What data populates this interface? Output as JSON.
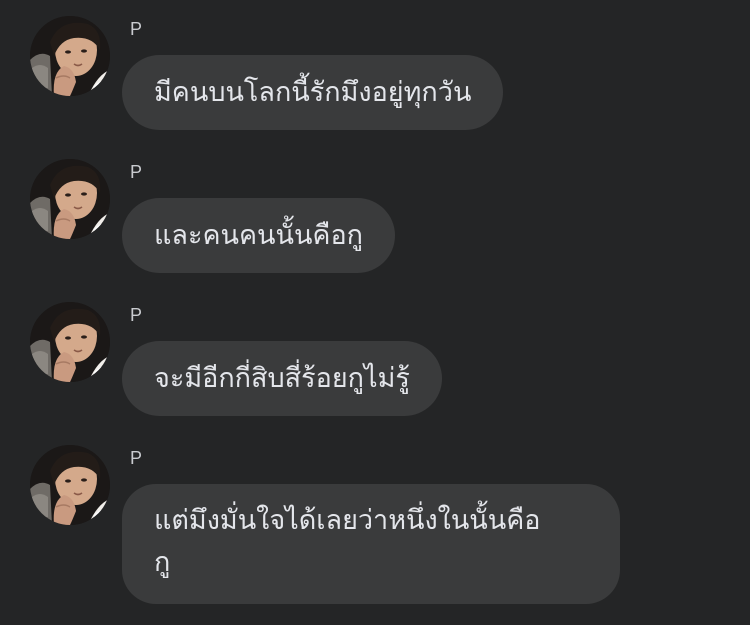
{
  "messages": [
    {
      "sender": "P",
      "text": "มีคนบนโลกนี้รักมึงอยู่ทุกวัน"
    },
    {
      "sender": "P",
      "text": "และคนคนนั้นคือกู"
    },
    {
      "sender": "P",
      "text": "จะมีอีกกี่สิบสี่ร้อยกูไม่รู้"
    },
    {
      "sender": "P",
      "text": "แต่มึงมั่นใจได้เลยว่าหนึ่งในนั้นคือ\nกู"
    }
  ],
  "colors": {
    "background": "#242526",
    "bubble": "#3a3b3c",
    "text": "#e4e6eb",
    "sender": "#c9cbcf"
  }
}
